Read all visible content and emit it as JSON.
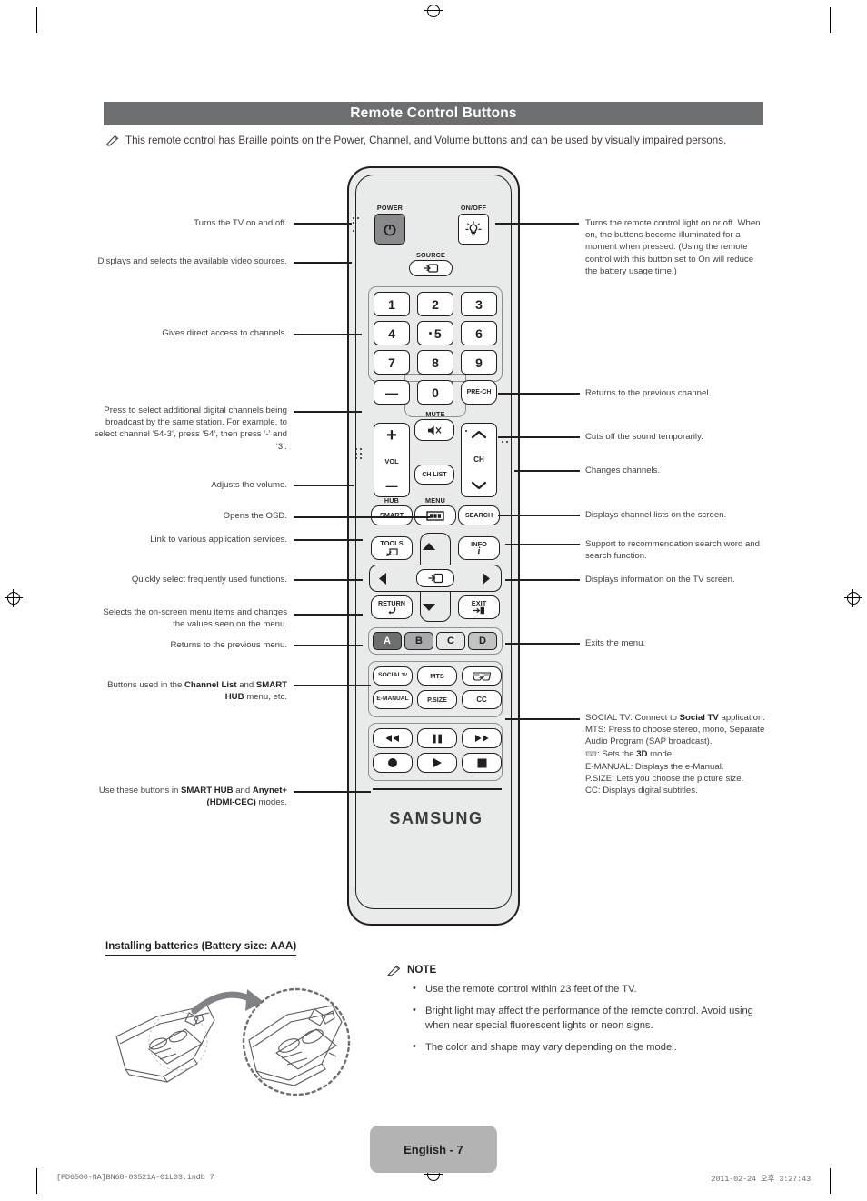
{
  "header": {
    "title": "Remote Control Buttons"
  },
  "intro": {
    "icon": "pencil-note-icon",
    "text": "This remote control has Braille points on the Power, Channel, and Volume buttons and can be used by visually impaired persons."
  },
  "remote": {
    "brand": "SAMSUNG",
    "labels": {
      "power": "POWER",
      "onoff": "ON/OFF",
      "source": "SOURCE",
      "mute": "MUTE",
      "hub": "HUB",
      "menu": "MENU",
      "vol": "VOL",
      "ch": "CH",
      "social_sup": "TV"
    },
    "buttons": {
      "power": "power-icon",
      "light": "bulb-icon",
      "source": "source-icon",
      "num1": "1",
      "num2": "2",
      "num3": "3",
      "num4": "4",
      "num5": "5",
      "num6": "6",
      "num7": "7",
      "num8": "8",
      "num9": "9",
      "dash": "—",
      "num0": "0",
      "prech": "PRE-CH",
      "mute": "mute-icon",
      "volplus": "+",
      "volminus": "—",
      "chlist": "CH LIST",
      "smart": "SMART",
      "menu": "menu-icon",
      "search": "SEARCH",
      "tools": "TOOLS",
      "info": "INFO",
      "enter": "enter-icon",
      "return": "RETURN",
      "exit": "EXIT",
      "up": "arrow-up-icon",
      "down": "arrow-down-icon",
      "left": "arrow-left-icon",
      "right": "arrow-right-icon",
      "a": "A",
      "b": "B",
      "c": "C",
      "d": "D",
      "social": "SOCIAL",
      "mts": "MTS",
      "three_d": "3d-glasses-icon",
      "emanual": "E-MANUAL",
      "psize": "P.SIZE",
      "cc": "CC",
      "rew": "rewind-icon",
      "pause": "pause-icon",
      "ff": "fast-forward-icon",
      "rec": "record-icon",
      "play": "play-icon",
      "stop": "stop-icon"
    }
  },
  "annotations_left": [
    {
      "id": "power",
      "text": "Turns the TV on and off."
    },
    {
      "id": "source",
      "text": "Displays and selects the available video sources."
    },
    {
      "id": "numbers",
      "text": "Gives direct access to channels."
    },
    {
      "id": "dash",
      "text": "Press to select additional digital channels being broadcast by the same station. For example, to select channel ‘54-3’, press ‘54’, then press ‘-’ and ‘3’."
    },
    {
      "id": "vol",
      "text": "Adjusts the volume."
    },
    {
      "id": "menu",
      "text": "Opens the OSD."
    },
    {
      "id": "smart",
      "text": "Link to various application services."
    },
    {
      "id": "tools",
      "text": "Quickly select frequently used functions."
    },
    {
      "id": "nav",
      "text": "Selects the on-screen menu items and changes the values seen on the menu."
    },
    {
      "id": "return",
      "text": "Returns to the previous menu."
    },
    {
      "id": "abcd",
      "html": "Buttons used in the <b>Channel List</b> and <b>SMART HUB</b> menu, etc."
    },
    {
      "id": "media",
      "html": "Use these buttons in <b>SMART HUB</b> and <b>Anynet+ (HDMI-CEC)</b> modes."
    }
  ],
  "annotations_right": [
    {
      "id": "onoff",
      "text": "Turns the remote control light on or off. When on, the buttons become illuminated for a moment when pressed. (Using the remote control with this button set to On will reduce the battery usage time.)"
    },
    {
      "id": "prech",
      "text": "Returns to the previous channel."
    },
    {
      "id": "mute",
      "text": "Cuts off the sound temporarily."
    },
    {
      "id": "ch",
      "text": "Changes channels."
    },
    {
      "id": "chlist",
      "text": "Displays channel lists on the screen."
    },
    {
      "id": "search",
      "text": "Support to recommendation search word and search function."
    },
    {
      "id": "info",
      "text": "Displays information on the TV screen."
    },
    {
      "id": "exit",
      "text": "Exits the menu."
    }
  ],
  "annotation_function_keys": {
    "line1_pre": "SOCIAL TV: Connect to ",
    "line1_bold": "Social TV",
    "line1_post": " application.",
    "line2": "MTS: Press to choose stereo, mono, Separate Audio Program (SAP broadcast).",
    "line3_pre": ": Sets the ",
    "line3_bold": "3D",
    "line3_post": " mode.",
    "line4": "E-MANUAL: Displays the e-Manual.",
    "line5": "P.SIZE: Lets you choose the picture size.",
    "line6": "CC: Displays digital subtitles."
  },
  "battery": {
    "title": "Installing batteries (Battery size: AAA)",
    "diagram": "remote-battery-compartment-illustration"
  },
  "note": {
    "heading": "NOTE",
    "items": [
      "Use the remote control within 23 feet of the TV.",
      "Bright light may affect the performance of the remote control. Avoid using when near special fluorescent lights or neon signs.",
      "The color and shape may vary depending on the model."
    ]
  },
  "footer": {
    "page_label": "English - 7",
    "file_ref": "[PD6500-NA]BN68-03521A-01L03.indb   7",
    "timestamp": "2011-02-24   오후 3:27:43"
  },
  "colors": {
    "header_bg": "#6d6e70",
    "page_box_bg": "#b3b3b3",
    "remote_body": "#e9eaea",
    "ink": "#231f20"
  }
}
